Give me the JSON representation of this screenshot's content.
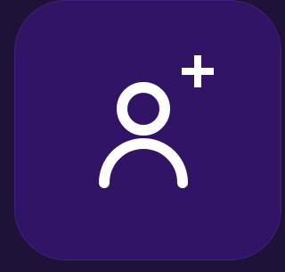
{
  "colors": {
    "page_background": "#1e1238",
    "button_background": "#321466",
    "button_border": "#43207e",
    "icon": "#ffffff"
  },
  "add_user_button": {
    "icon": "user-plus-icon",
    "label": ""
  }
}
